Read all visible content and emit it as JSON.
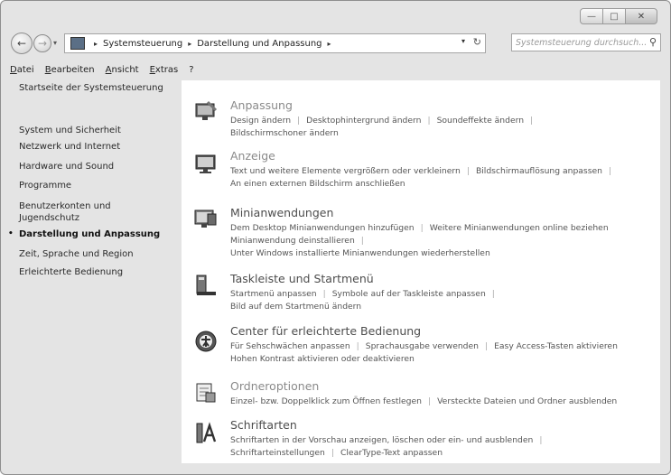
{
  "window": {
    "buttons": {
      "minimize": "—",
      "maximize": "□",
      "close": "✕"
    }
  },
  "nav": {
    "back": "←",
    "forward": "→",
    "history": "▾",
    "breadcrumb": [
      "Systemsteuerung",
      "Darstellung und Anpassung"
    ],
    "separator": "▸",
    "dropdown": "▾",
    "refresh": "↻",
    "search_placeholder": "Systemsteuerung durchsuch...",
    "search_icon": "⚲"
  },
  "menu": [
    "Datei",
    "Bearbeiten",
    "Ansicht",
    "Extras",
    "?"
  ],
  "sidebar": {
    "items": [
      {
        "label": "Startseite der Systemsteuerung",
        "active": false
      },
      {
        "label": "System und Sicherheit",
        "active": false
      },
      {
        "label": "Netzwerk und Internet",
        "active": false
      },
      {
        "label": "Hardware und Sound",
        "active": false
      },
      {
        "label": "Programme",
        "active": false
      },
      {
        "label": "Benutzerkonten und Jugendschutz",
        "active": false
      },
      {
        "label": "Darstellung und Anpassung",
        "active": true
      },
      {
        "label": "Zeit, Sprache und Region",
        "active": false
      },
      {
        "label": "Erleichterte Bedienung",
        "active": false
      }
    ],
    "bullet": "•"
  },
  "categories": [
    {
      "title": "Anpassung",
      "icon": "personalization-icon",
      "rows": [
        [
          "Design ändern",
          "Desktophintergrund ändern",
          "Soundeffekte ändern"
        ],
        [
          "Bildschirmschoner ändern"
        ]
      ]
    },
    {
      "title": "Anzeige",
      "icon": "display-icon",
      "rows": [
        [
          "Text und weitere Elemente vergrößern oder verkleinern",
          "Bildschirmauflösung anpassen"
        ],
        [
          "An einen externen Bildschirm anschließen"
        ]
      ]
    },
    {
      "title": "Minianwendungen",
      "icon": "gadgets-icon",
      "rows": [
        [
          "Dem Desktop Minianwendungen hinzufügen",
          "Weitere Minianwendungen online beziehen"
        ],
        [
          "Minianwendung deinstallieren"
        ],
        [
          "Unter Windows installierte Minianwendungen wiederherstellen"
        ]
      ]
    },
    {
      "title": "Taskleiste und Startmenü",
      "icon": "taskbar-icon",
      "rows": [
        [
          "Startmenü anpassen",
          "Symbole auf der Taskleiste anpassen"
        ],
        [
          "Bild auf dem Startmenü ändern"
        ]
      ]
    },
    {
      "title": "Center für erleichterte Bedienung",
      "icon": "ease-of-access-icon",
      "rows": [
        [
          "Für Sehschwächen anpassen",
          "Sprachausgabe verwenden",
          "Easy Access-Tasten aktivieren"
        ],
        [
          "Hohen Kontrast aktivieren oder deaktivieren"
        ]
      ]
    },
    {
      "title": "Ordneroptionen",
      "icon": "folder-options-icon",
      "rows": [
        [
          "Einzel- bzw. Doppelklick zum Öffnen festlegen",
          "Versteckte Dateien und Ordner ausblenden"
        ]
      ]
    },
    {
      "title": "Schriftarten",
      "icon": "fonts-icon",
      "rows": [
        [
          "Schriftarten in der Vorschau anzeigen, löschen oder ein- und ausblenden"
        ],
        [
          "Schriftarteinstellungen",
          "ClearType-Text anpassen"
        ]
      ]
    }
  ],
  "colors": {
    "sidebar_bg": "#e4e4e4",
    "panel_bg": "#ffffff",
    "text": "#4d4d4d"
  }
}
